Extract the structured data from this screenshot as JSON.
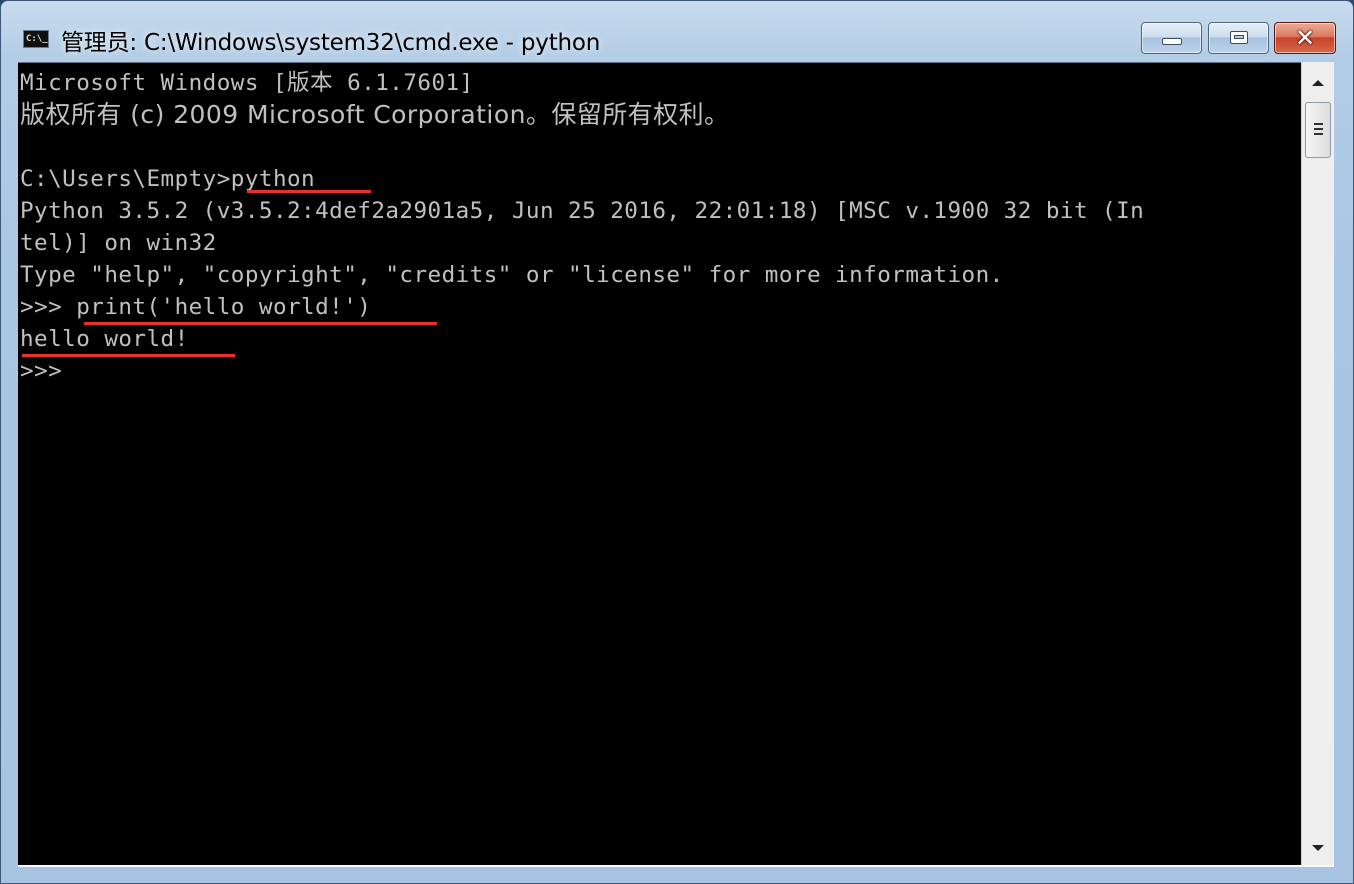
{
  "window": {
    "title": "管理员: C:\\Windows\\system32\\cmd.exe - python",
    "icon": "cmd-icon",
    "icon_text": "C:\\_",
    "controls": {
      "minimize": "minimize-icon",
      "maximize": "maximize-icon",
      "close": "close-icon",
      "close_glyph": "✕"
    }
  },
  "console": {
    "lines": [
      "Microsoft Windows [版本 6.1.7601]",
      "版权所有 (c) 2009 Microsoft Corporation。保留所有权利。",
      "",
      "C:\\Users\\Empty>python",
      "Python 3.5.2 (v3.5.2:4def2a2901a5, Jun 25 2016, 22:01:18) [MSC v.1900 32 bit (In",
      "tel)] on win32",
      "Type \"help\", \"copyright\", \"credits\" or \"license\" for more information.",
      ">>> print('hello world!')",
      "hello world!",
      ">>>"
    ],
    "text_color": "#c0c0c0",
    "background": "#000000",
    "highlight_color": "#e8312a"
  },
  "scrollbar": {
    "up": "scroll-up-arrow-icon",
    "down": "scroll-down-arrow-icon"
  }
}
